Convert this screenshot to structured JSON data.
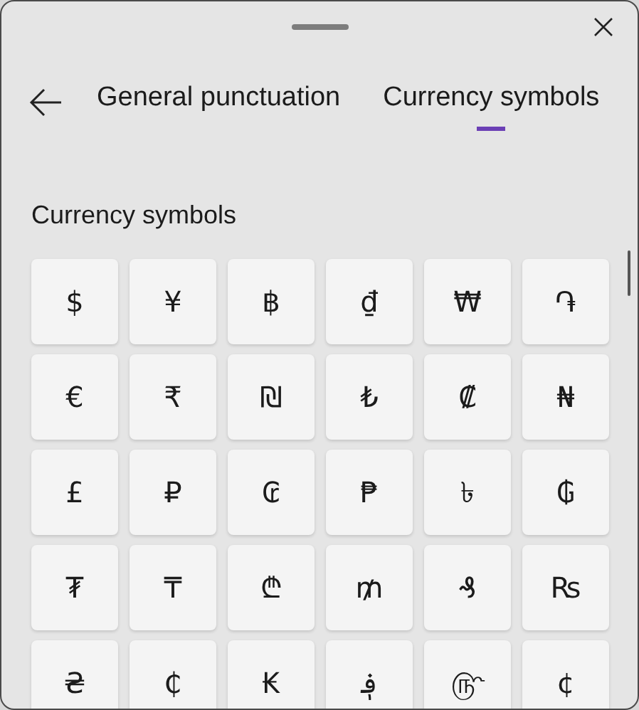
{
  "tabs": [
    {
      "label": "General punctuation",
      "selected": false
    },
    {
      "label": "Currency symbols",
      "selected": true
    }
  ],
  "section_title": "Currency symbols",
  "symbols": [
    "$",
    "¥",
    "฿",
    "₫",
    "₩",
    "֏",
    "€",
    "₹",
    "₪",
    "₺",
    "₡",
    "₦",
    "£",
    "₽",
    "₢",
    "₱",
    "৳",
    "₲",
    "₮",
    "₸",
    "₾",
    "₥",
    "₰",
    "₨",
    "₴",
    "₵",
    "₭",
    "؋",
    "௹",
    "¢"
  ]
}
